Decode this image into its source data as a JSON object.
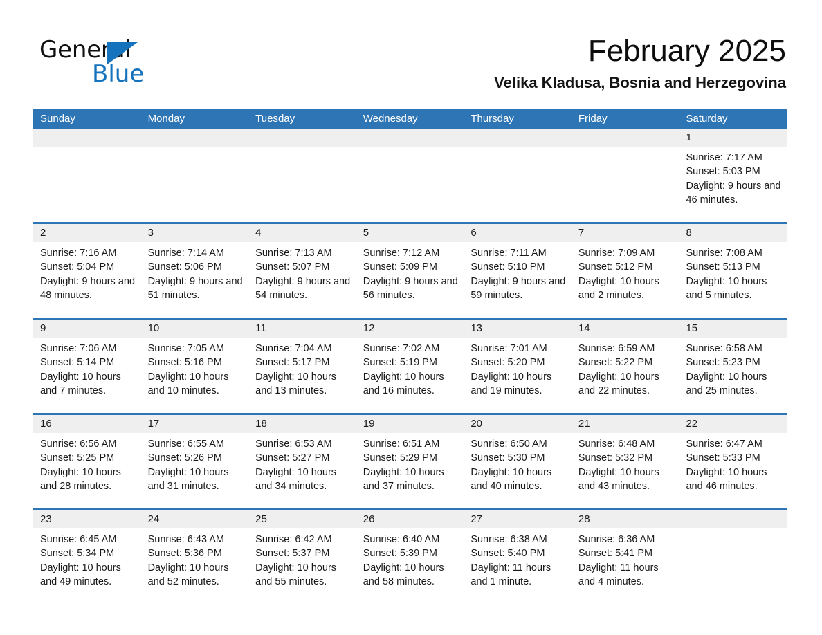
{
  "brand": {
    "name_part1": "General",
    "name_part2": "Blue",
    "accent_color": "#1573bd",
    "triangle_icon": "triangle-icon"
  },
  "header": {
    "title": "February 2025",
    "subtitle": "Velika Kladusa, Bosnia and Herzegovina"
  },
  "theme": {
    "header_blue": "#2e75b6",
    "day_band_gray": "#efefef",
    "text_dark": "#1a1a1a"
  },
  "weekdays": [
    "Sunday",
    "Monday",
    "Tuesday",
    "Wednesday",
    "Thursday",
    "Friday",
    "Saturday"
  ],
  "weeks": [
    [
      {
        "day": "",
        "empty": true
      },
      {
        "day": "",
        "empty": true
      },
      {
        "day": "",
        "empty": true
      },
      {
        "day": "",
        "empty": true
      },
      {
        "day": "",
        "empty": true
      },
      {
        "day": "",
        "empty": true
      },
      {
        "day": "1",
        "sunrise": "Sunrise: 7:17 AM",
        "sunset": "Sunset: 5:03 PM",
        "daylight": "Daylight: 9 hours and 46 minutes."
      }
    ],
    [
      {
        "day": "2",
        "sunrise": "Sunrise: 7:16 AM",
        "sunset": "Sunset: 5:04 PM",
        "daylight": "Daylight: 9 hours and 48 minutes."
      },
      {
        "day": "3",
        "sunrise": "Sunrise: 7:14 AM",
        "sunset": "Sunset: 5:06 PM",
        "daylight": "Daylight: 9 hours and 51 minutes."
      },
      {
        "day": "4",
        "sunrise": "Sunrise: 7:13 AM",
        "sunset": "Sunset: 5:07 PM",
        "daylight": "Daylight: 9 hours and 54 minutes."
      },
      {
        "day": "5",
        "sunrise": "Sunrise: 7:12 AM",
        "sunset": "Sunset: 5:09 PM",
        "daylight": "Daylight: 9 hours and 56 minutes."
      },
      {
        "day": "6",
        "sunrise": "Sunrise: 7:11 AM",
        "sunset": "Sunset: 5:10 PM",
        "daylight": "Daylight: 9 hours and 59 minutes."
      },
      {
        "day": "7",
        "sunrise": "Sunrise: 7:09 AM",
        "sunset": "Sunset: 5:12 PM",
        "daylight": "Daylight: 10 hours and 2 minutes."
      },
      {
        "day": "8",
        "sunrise": "Sunrise: 7:08 AM",
        "sunset": "Sunset: 5:13 PM",
        "daylight": "Daylight: 10 hours and 5 minutes."
      }
    ],
    [
      {
        "day": "9",
        "sunrise": "Sunrise: 7:06 AM",
        "sunset": "Sunset: 5:14 PM",
        "daylight": "Daylight: 10 hours and 7 minutes."
      },
      {
        "day": "10",
        "sunrise": "Sunrise: 7:05 AM",
        "sunset": "Sunset: 5:16 PM",
        "daylight": "Daylight: 10 hours and 10 minutes."
      },
      {
        "day": "11",
        "sunrise": "Sunrise: 7:04 AM",
        "sunset": "Sunset: 5:17 PM",
        "daylight": "Daylight: 10 hours and 13 minutes."
      },
      {
        "day": "12",
        "sunrise": "Sunrise: 7:02 AM",
        "sunset": "Sunset: 5:19 PM",
        "daylight": "Daylight: 10 hours and 16 minutes."
      },
      {
        "day": "13",
        "sunrise": "Sunrise: 7:01 AM",
        "sunset": "Sunset: 5:20 PM",
        "daylight": "Daylight: 10 hours and 19 minutes."
      },
      {
        "day": "14",
        "sunrise": "Sunrise: 6:59 AM",
        "sunset": "Sunset: 5:22 PM",
        "daylight": "Daylight: 10 hours and 22 minutes."
      },
      {
        "day": "15",
        "sunrise": "Sunrise: 6:58 AM",
        "sunset": "Sunset: 5:23 PM",
        "daylight": "Daylight: 10 hours and 25 minutes."
      }
    ],
    [
      {
        "day": "16",
        "sunrise": "Sunrise: 6:56 AM",
        "sunset": "Sunset: 5:25 PM",
        "daylight": "Daylight: 10 hours and 28 minutes."
      },
      {
        "day": "17",
        "sunrise": "Sunrise: 6:55 AM",
        "sunset": "Sunset: 5:26 PM",
        "daylight": "Daylight: 10 hours and 31 minutes."
      },
      {
        "day": "18",
        "sunrise": "Sunrise: 6:53 AM",
        "sunset": "Sunset: 5:27 PM",
        "daylight": "Daylight: 10 hours and 34 minutes."
      },
      {
        "day": "19",
        "sunrise": "Sunrise: 6:51 AM",
        "sunset": "Sunset: 5:29 PM",
        "daylight": "Daylight: 10 hours and 37 minutes."
      },
      {
        "day": "20",
        "sunrise": "Sunrise: 6:50 AM",
        "sunset": "Sunset: 5:30 PM",
        "daylight": "Daylight: 10 hours and 40 minutes."
      },
      {
        "day": "21",
        "sunrise": "Sunrise: 6:48 AM",
        "sunset": "Sunset: 5:32 PM",
        "daylight": "Daylight: 10 hours and 43 minutes."
      },
      {
        "day": "22",
        "sunrise": "Sunrise: 6:47 AM",
        "sunset": "Sunset: 5:33 PM",
        "daylight": "Daylight: 10 hours and 46 minutes."
      }
    ],
    [
      {
        "day": "23",
        "sunrise": "Sunrise: 6:45 AM",
        "sunset": "Sunset: 5:34 PM",
        "daylight": "Daylight: 10 hours and 49 minutes."
      },
      {
        "day": "24",
        "sunrise": "Sunrise: 6:43 AM",
        "sunset": "Sunset: 5:36 PM",
        "daylight": "Daylight: 10 hours and 52 minutes."
      },
      {
        "day": "25",
        "sunrise": "Sunrise: 6:42 AM",
        "sunset": "Sunset: 5:37 PM",
        "daylight": "Daylight: 10 hours and 55 minutes."
      },
      {
        "day": "26",
        "sunrise": "Sunrise: 6:40 AM",
        "sunset": "Sunset: 5:39 PM",
        "daylight": "Daylight: 10 hours and 58 minutes."
      },
      {
        "day": "27",
        "sunrise": "Sunrise: 6:38 AM",
        "sunset": "Sunset: 5:40 PM",
        "daylight": "Daylight: 11 hours and 1 minute."
      },
      {
        "day": "28",
        "sunrise": "Sunrise: 6:36 AM",
        "sunset": "Sunset: 5:41 PM",
        "daylight": "Daylight: 11 hours and 4 minutes."
      },
      {
        "day": "",
        "empty": true
      }
    ]
  ]
}
